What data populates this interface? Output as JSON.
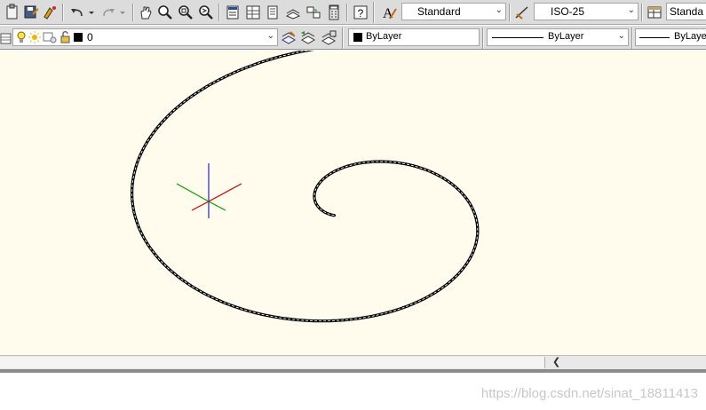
{
  "toolbar_standard": {
    "icons": [
      "clipboard-icon",
      "save-as-icon",
      "match-properties-icon",
      "undo-icon",
      "redo-icon",
      "pan-icon",
      "zoom-realtime-icon",
      "zoom-window-icon",
      "zoom-previous-icon",
      "properties-icon",
      "design-center-icon",
      "tool-palettes-icon",
      "sheet-set-icon",
      "markup-icon",
      "calculator-icon",
      "help-icon"
    ]
  },
  "styles": {
    "text_style": "Standard",
    "dim_style": "ISO-25",
    "table_style": "Standa"
  },
  "layers": {
    "current_layer": "0",
    "color": "ByLayer",
    "linetype": "ByLayer",
    "lineweight": "ByLayer"
  },
  "watermark": "https://blog.csdn.net/sinat_18811413",
  "colors": {
    "canvas_bg": "#fffcee",
    "toolbar_bg": "#dcdcdc",
    "ucs_x": "#cc0000",
    "ucs_y": "#00a000",
    "ucs_z": "#0000cc"
  }
}
